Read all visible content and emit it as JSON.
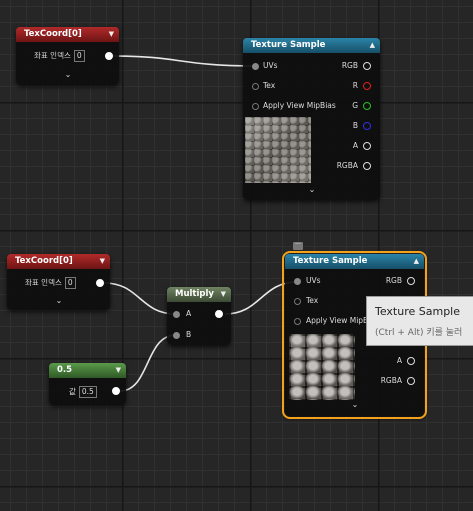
{
  "nodes": {
    "texcoord_top": {
      "title": "TexCoord[0]",
      "field_label": "좌표 인덱스",
      "field_value": "0"
    },
    "texture_sample_top": {
      "title": "Texture Sample",
      "inputs": [
        "UVs",
        "Tex",
        "Apply View MipBias"
      ],
      "outputs": [
        "RGB",
        "R",
        "G",
        "B",
        "A",
        "RGBA"
      ]
    },
    "texcoord_bottom": {
      "title": "TexCoord[0]",
      "field_label": "좌표 인덱스",
      "field_value": "0"
    },
    "multiply": {
      "title": "Multiply",
      "inputs": [
        "A",
        "B"
      ]
    },
    "constant": {
      "title": "0.5",
      "field_label": "값",
      "field_value": "0.5"
    },
    "texture_sample_bottom": {
      "title": "Texture Sample",
      "inputs": [
        "UVs",
        "Tex",
        "Apply View MipBias"
      ],
      "outputs": [
        "RGB",
        "A",
        "RGBA"
      ]
    }
  },
  "tooltip": {
    "title": "Texture Sample",
    "subtitle": "(Ctrl + Alt) 키를 눌러"
  },
  "colors": {
    "texcoord_header": "#a52323",
    "texture_header": "#1f6c8c",
    "constant_header": "#4f8a3f",
    "multiply_header": "#5a6d4e",
    "selection": "#f2a31b",
    "pin_r": "#e02020",
    "pin_g": "#26c326",
    "pin_b": "#3030e8"
  },
  "icons": [
    "chevron-down-icon",
    "pin-icon",
    "comment-icon"
  ]
}
